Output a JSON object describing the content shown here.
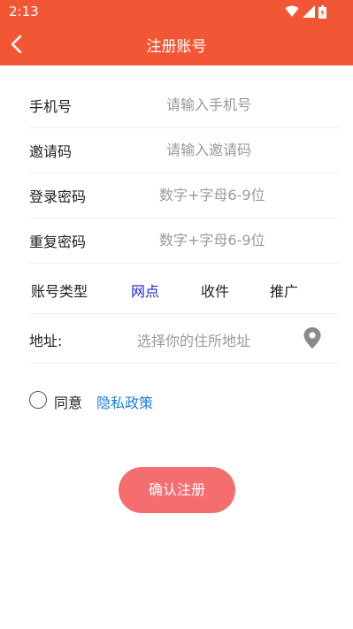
{
  "status_bar": {
    "time": "2:13",
    "icons": [
      "wifi-icon",
      "signal-icon",
      "battery-icon"
    ]
  },
  "app_bar": {
    "title": "注册账号",
    "back_icon": "chevron-left-icon"
  },
  "form": {
    "phone": {
      "label": "手机号",
      "placeholder": "请输入手机号",
      "value": ""
    },
    "invite": {
      "label": "邀请码",
      "placeholder": "请输入邀请码",
      "value": ""
    },
    "password": {
      "label": "登录密码",
      "placeholder": "数字+字母6-9位",
      "value": ""
    },
    "confirm_password": {
      "label": "重复密码",
      "placeholder": "数字+字母6-9位",
      "value": ""
    },
    "account_type": {
      "label": "账号类型",
      "options": [
        "网点",
        "收件",
        "推广"
      ],
      "selected": "网点"
    },
    "address": {
      "label": "地址:",
      "placeholder": "选择你的住所地址",
      "icon": "location-pin-icon"
    }
  },
  "agreement": {
    "agree_text": "同意",
    "policy_link": "隐私政策",
    "checked": false
  },
  "submit_label": "确认注册",
  "colors": {
    "header": "#f35634",
    "submit_button": "#f46d6f",
    "selected_option": "#1a1fd6",
    "link": "#1b7fe0"
  }
}
